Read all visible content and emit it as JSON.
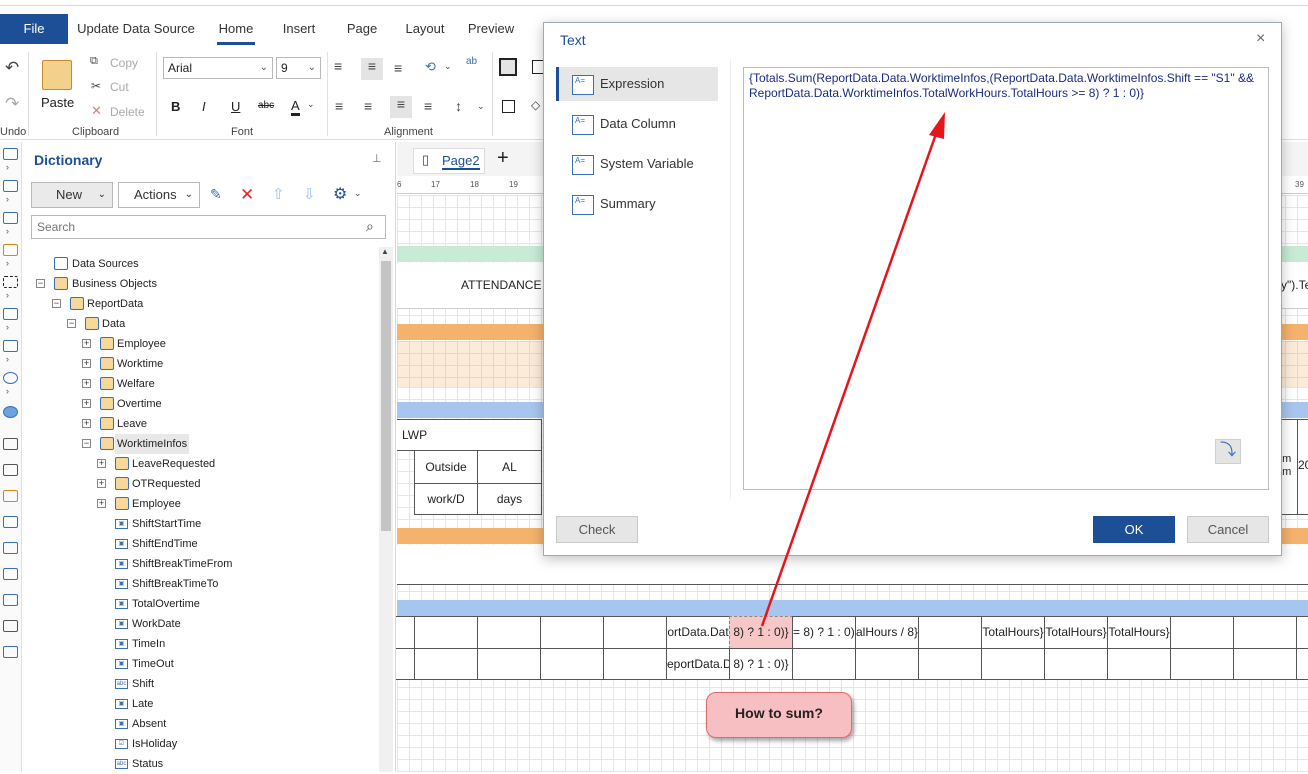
{
  "menu": {
    "file": "File",
    "tabs": [
      "Update Data Source",
      "Home",
      "Insert",
      "Page",
      "Layout",
      "Preview"
    ]
  },
  "ribbon": {
    "undo": "Undo",
    "paste": "Paste",
    "copy": "Copy",
    "cut": "Cut",
    "delete": "Delete",
    "clipboard": "Clipboard",
    "font_name": "Arial",
    "font_size": "9",
    "font": "Font",
    "alignment": "Alignment",
    "bold": "B",
    "italic": "I",
    "underline": "U",
    "strike": "abc",
    "fontcolor": "A"
  },
  "dictionary": {
    "title": "Dictionary",
    "new": "New",
    "actions": "Actions",
    "search_placeholder": "Search",
    "tree": {
      "data_sources": "Data Sources",
      "business_objects": "Business Objects",
      "report_data": "ReportData",
      "data": "Data",
      "employee": "Employee",
      "worktime": "Worktime",
      "welfare": "Welfare",
      "overtime": "Overtime",
      "leave": "Leave",
      "worktime_infos": "WorktimeInfos",
      "leave_requested": "LeaveRequested",
      "ot_requested": "OTRequested",
      "employee2": "Employee",
      "fields": [
        "ShiftStartTime",
        "ShiftEndTime",
        "ShiftBreakTimeFrom",
        "ShiftBreakTimeTo",
        "TotalOvertime",
        "WorkDate",
        "TimeIn",
        "TimeOut",
        "Shift",
        "Late",
        "Absent",
        "IsHoliday",
        "Status"
      ]
    }
  },
  "report": {
    "page_tab": "Page2",
    "add": "+",
    "ruler": [
      "6",
      "17",
      "18",
      "19",
      "39"
    ],
    "attendance": "ATTENDANCE",
    "right_frag": "y\").Te",
    "lwp": "LWP",
    "outside": "Outside",
    "al": "AL",
    "workd": "work/D",
    "days": "days",
    "right_om": "om",
    "right_am": "am",
    "right_20": "20",
    "row1": {
      "c1": "ortData.Dat",
      "c2": "8) ? 1 : 0)}",
      "c3": "= 8) ? 1 : 0)}",
      "c4": "alHours / 8}",
      "c5": "TotalHours}",
      "c6": "TotalHours}",
      "c7": "TotalHours}"
    },
    "row2": {
      "c1": "eportData.D",
      "c2": "8) ? 1 : 0)}"
    }
  },
  "dialog": {
    "title": "Text",
    "close": "×",
    "nav": [
      "Expression",
      "Data Column",
      "System Variable",
      "Summary"
    ],
    "expression": "{Totals.Sum(ReportData.Data.WorktimeInfos,(ReportData.Data.WorktimeInfos.Shift == \"S1\" && ReportData.Data.WorktimeInfos.TotalWorkHours.TotalHours >= 8) ? 1 : 0)}",
    "check": "Check",
    "ok": "OK",
    "cancel": "Cancel"
  },
  "callout": "How to sum?",
  "colors": {
    "accent": "#1c4f95",
    "arrow": "#e8141b",
    "green_band": "#c7ebd5",
    "orange_band": "#f5b26c",
    "blue_band": "#a6c6ef"
  }
}
